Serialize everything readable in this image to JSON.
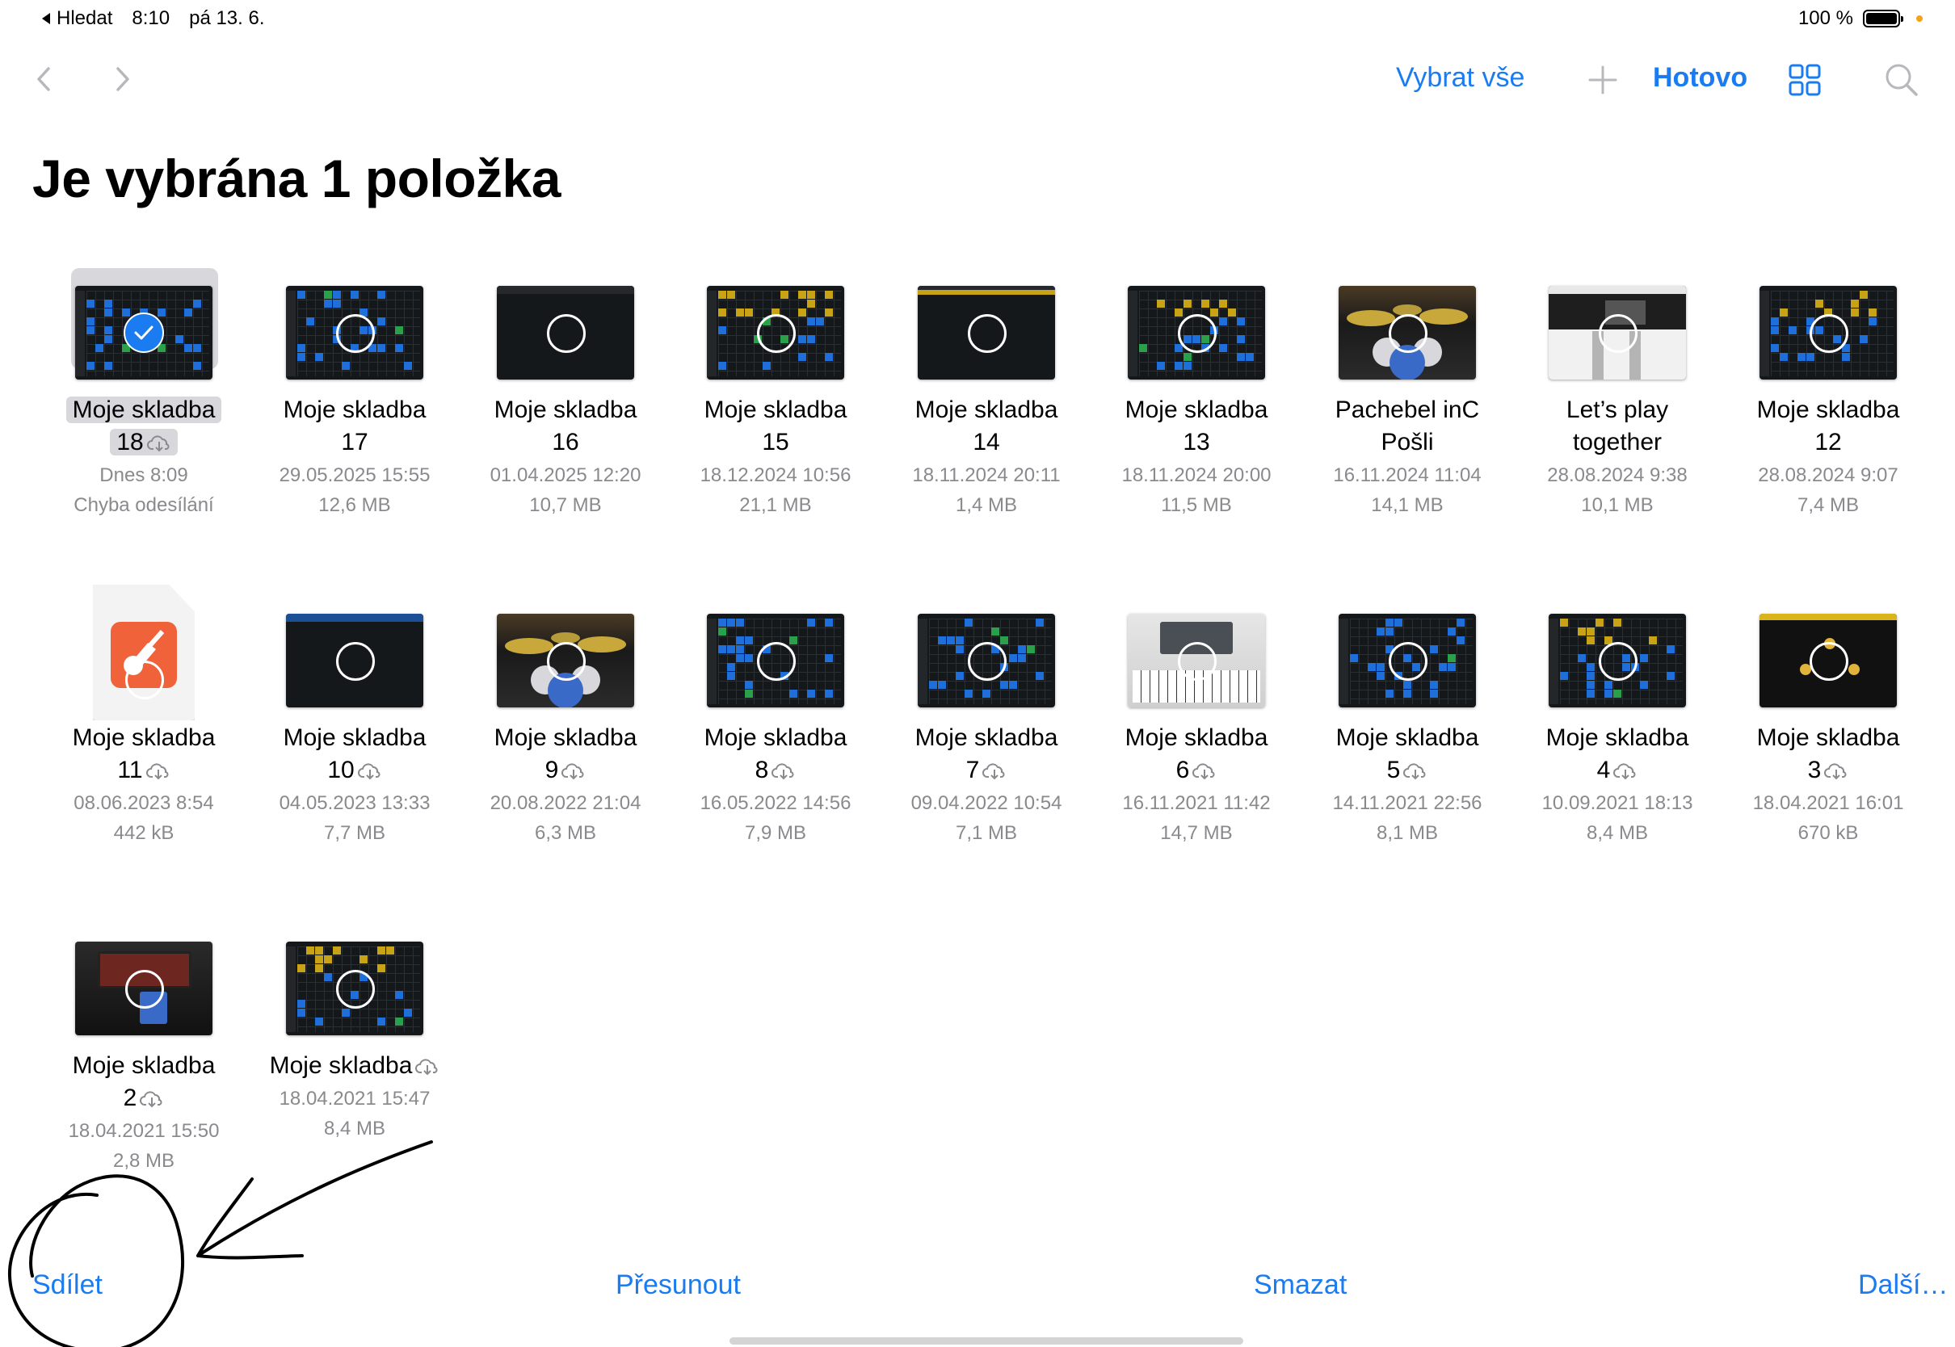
{
  "status_bar": {
    "back_label": "Hledat",
    "time": "8:10",
    "date": "pá 13. 6.",
    "battery": "100 %"
  },
  "toolbar": {
    "select_all": "Vybrat vše",
    "done": "Hotovo"
  },
  "title": "Je vybrána 1 položka",
  "files": [
    {
      "name1": "Moje skladba",
      "name2": "18",
      "date": "Dnes 8:09",
      "meta2": "Chyba odesílání",
      "selected": true,
      "cloud": true
    },
    {
      "name1": "Moje skladba",
      "name2": "17",
      "date": "29.05.2025 15:55",
      "meta2": "12,6 MB"
    },
    {
      "name1": "Moje skladba",
      "name2": "16",
      "date": "01.04.2025 12:20",
      "meta2": "10,7 MB"
    },
    {
      "name1": "Moje skladba",
      "name2": "15",
      "date": "18.12.2024 10:56",
      "meta2": "21,1 MB"
    },
    {
      "name1": "Moje skladba",
      "name2": "14",
      "date": "18.11.2024 20:11",
      "meta2": "1,4 MB"
    },
    {
      "name1": "Moje skladba",
      "name2": "13",
      "date": "18.11.2024 20:00",
      "meta2": "11,5 MB"
    },
    {
      "name1": "Pachebel inC",
      "name2": "Pošli",
      "date": "16.11.2024 11:04",
      "meta2": "14,1 MB"
    },
    {
      "name1": "Let’s play",
      "name2": "together",
      "date": "28.08.2024 9:38",
      "meta2": "10,1 MB"
    },
    {
      "name1": "Moje skladba",
      "name2": "12",
      "date": "28.08.2024 9:07",
      "meta2": "7,4 MB"
    },
    {
      "name1": "Moje skladba",
      "name2": "11",
      "date": "08.06.2023 8:54",
      "meta2": "442 kB",
      "cloud": true
    },
    {
      "name1": "Moje skladba",
      "name2": "10",
      "date": "04.05.2023 13:33",
      "meta2": "7,7 MB",
      "cloud": true
    },
    {
      "name1": "Moje skladba",
      "name2": "9",
      "date": "20.08.2022 21:04",
      "meta2": "6,3 MB",
      "cloud": true
    },
    {
      "name1": "Moje skladba",
      "name2": "8",
      "date": "16.05.2022 14:56",
      "meta2": "7,9 MB",
      "cloud": true
    },
    {
      "name1": "Moje skladba",
      "name2": "7",
      "date": "09.04.2022 10:54",
      "meta2": "7,1 MB",
      "cloud": true
    },
    {
      "name1": "Moje skladba",
      "name2": "6",
      "date": "16.11.2021 11:42",
      "meta2": "14,7 MB",
      "cloud": true
    },
    {
      "name1": "Moje skladba",
      "name2": "5",
      "date": "14.11.2021 22:56",
      "meta2": "8,1 MB",
      "cloud": true
    },
    {
      "name1": "Moje skladba",
      "name2": "4",
      "date": "10.09.2021 18:13",
      "meta2": "8,4 MB",
      "cloud": true
    },
    {
      "name1": "Moje skladba",
      "name2": "3",
      "date": "18.04.2021 16:01",
      "meta2": "670 kB",
      "cloud": true
    },
    {
      "name1": "Moje skladba",
      "name2": "2",
      "date": "18.04.2021 15:50",
      "meta2": "2,8 MB",
      "cloud": true
    },
    {
      "name1": "Moje skladba",
      "name2": "",
      "date": "18.04.2021 15:47",
      "meta2": "8,4 MB",
      "cloud": true
    }
  ],
  "bottom_bar": {
    "share": "Sdílet",
    "move": "Přesunout",
    "delete": "Smazat",
    "more": "Další…"
  },
  "colors": {
    "accent": "#1a7cf0",
    "secondary_text": "#8a8a8e",
    "selection_bg": "#d8d8dc",
    "annotation_ink": "#000000"
  },
  "icons": [
    "back-chevron-icon",
    "forward-chevron-icon",
    "add-icon",
    "grid-view-icon",
    "search-icon",
    "checkmark-icon",
    "select-circle-icon",
    "cloud-download-icon",
    "garageband-file-icon"
  ]
}
